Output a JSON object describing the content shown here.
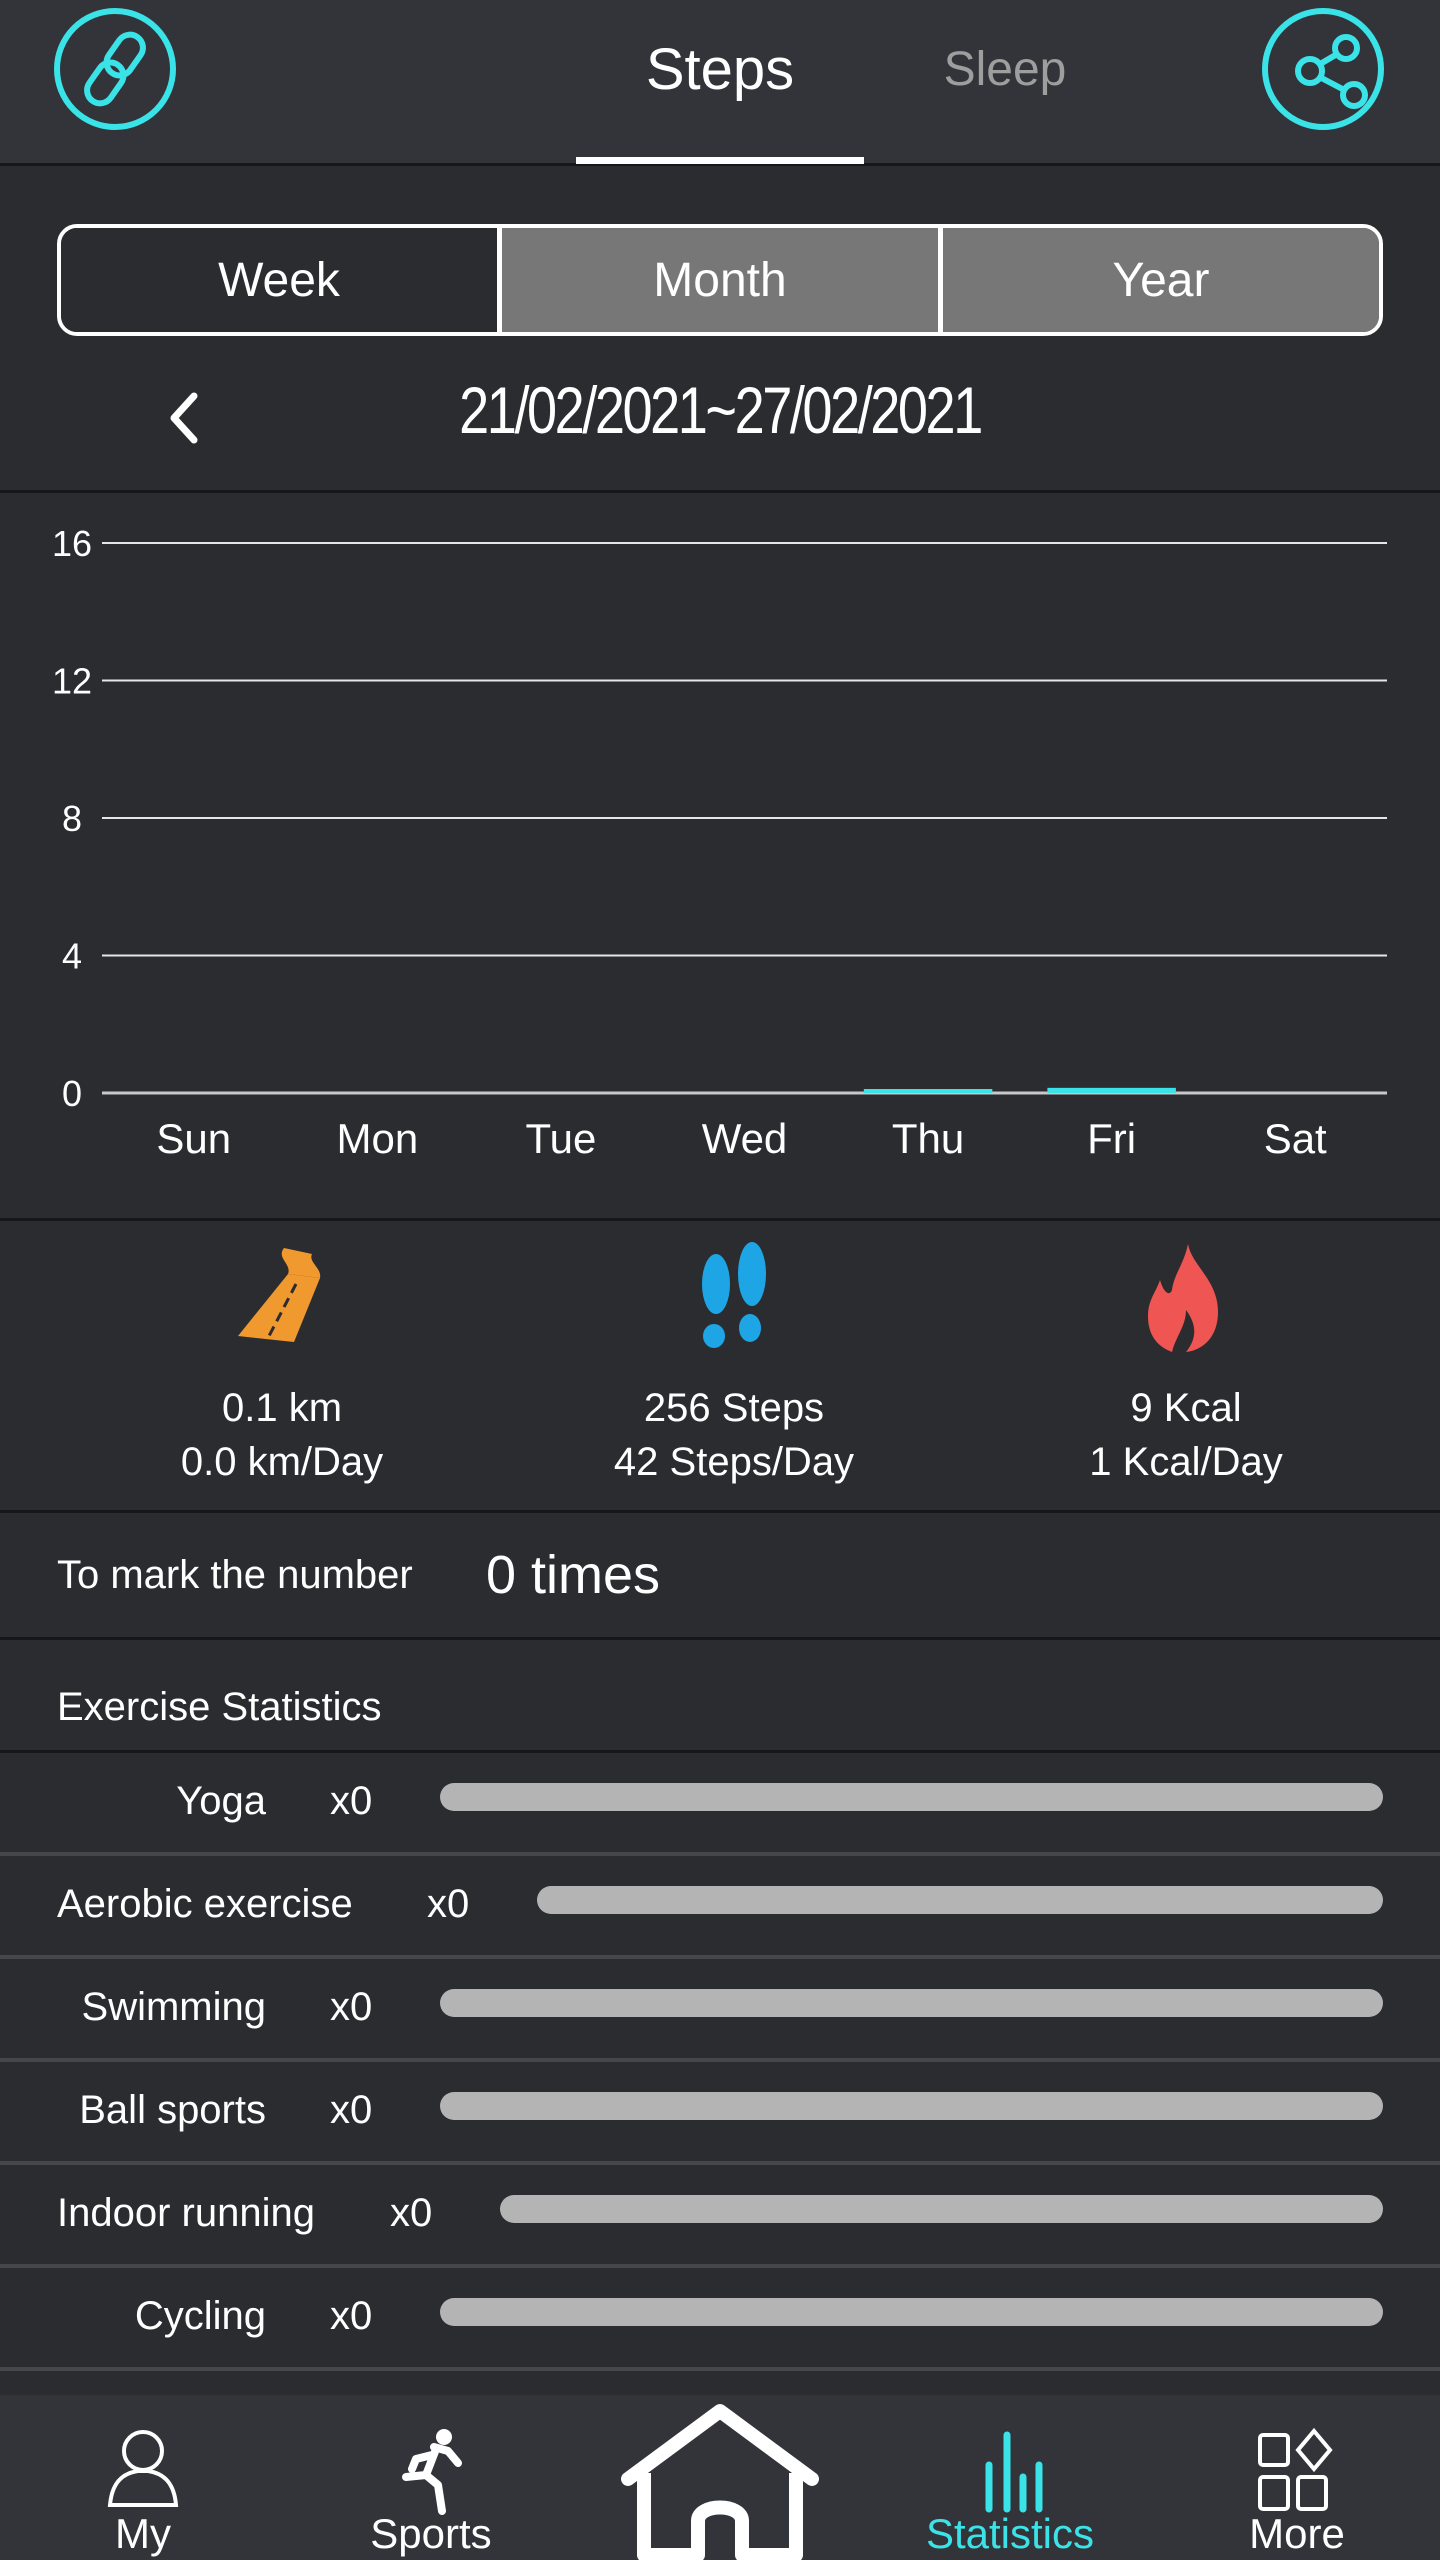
{
  "header": {
    "left_icon": "link-icon",
    "right_icon": "share-icon",
    "tabs": [
      {
        "label": "Steps",
        "active": true
      },
      {
        "label": "Sleep",
        "active": false
      }
    ],
    "accent_color": "#3ae3e8"
  },
  "period_selector": {
    "options": [
      {
        "label": "Week",
        "active": true
      },
      {
        "label": "Month",
        "active": false
      },
      {
        "label": "Year",
        "active": false
      }
    ]
  },
  "date_nav": {
    "prev_icon": "chevron-left-icon",
    "range": "21/02/2021~27/02/2021"
  },
  "chart_data": {
    "type": "bar",
    "title": "",
    "xlabel": "",
    "ylabel": "",
    "categories": [
      "Sun",
      "Mon",
      "Tue",
      "Wed",
      "Thu",
      "Fri",
      "Sat"
    ],
    "values": [
      0,
      0,
      0,
      0,
      0.1,
      0.15,
      0
    ],
    "ylim": [
      0,
      16
    ],
    "yticks": [
      0,
      4,
      8,
      12,
      16
    ],
    "grid": true,
    "bar_color": "#3ae3e8"
  },
  "summary": [
    {
      "icon": "road-icon",
      "color": "#f0992e",
      "total": "0.1 km",
      "per_day": "0.0 km/Day"
    },
    {
      "icon": "footprints-icon",
      "color": "#1ea5e6",
      "total": "256 Steps",
      "per_day": "42 Steps/Day"
    },
    {
      "icon": "flame-icon",
      "color": "#ef5552",
      "total": "9 Kcal",
      "per_day": "1 Kcal/Day"
    }
  ],
  "goal": {
    "label": "To mark the number",
    "value": "0 times"
  },
  "exercise": {
    "title": "Exercise Statistics",
    "items": [
      {
        "label": "Yoga",
        "count": "x0",
        "progress": 0
      },
      {
        "label": "Aerobic exercise",
        "count": "x0",
        "progress": 0
      },
      {
        "label": "Swimming",
        "count": "x0",
        "progress": 0
      },
      {
        "label": "Ball sports",
        "count": "x0",
        "progress": 0
      },
      {
        "label": "Indoor running",
        "count": "x0",
        "progress": 0
      },
      {
        "label": "Cycling",
        "count": "x0",
        "progress": 0
      }
    ]
  },
  "bottom_nav": {
    "items": [
      {
        "label": "My",
        "icon": "person-icon",
        "active": false
      },
      {
        "label": "Sports",
        "icon": "running-icon",
        "active": false
      },
      {
        "label": "",
        "icon": "home-icon",
        "active": false
      },
      {
        "label": "Statistics",
        "icon": "bar-chart-icon",
        "active": true
      },
      {
        "label": "More",
        "icon": "grid-icon",
        "active": false
      }
    ]
  }
}
